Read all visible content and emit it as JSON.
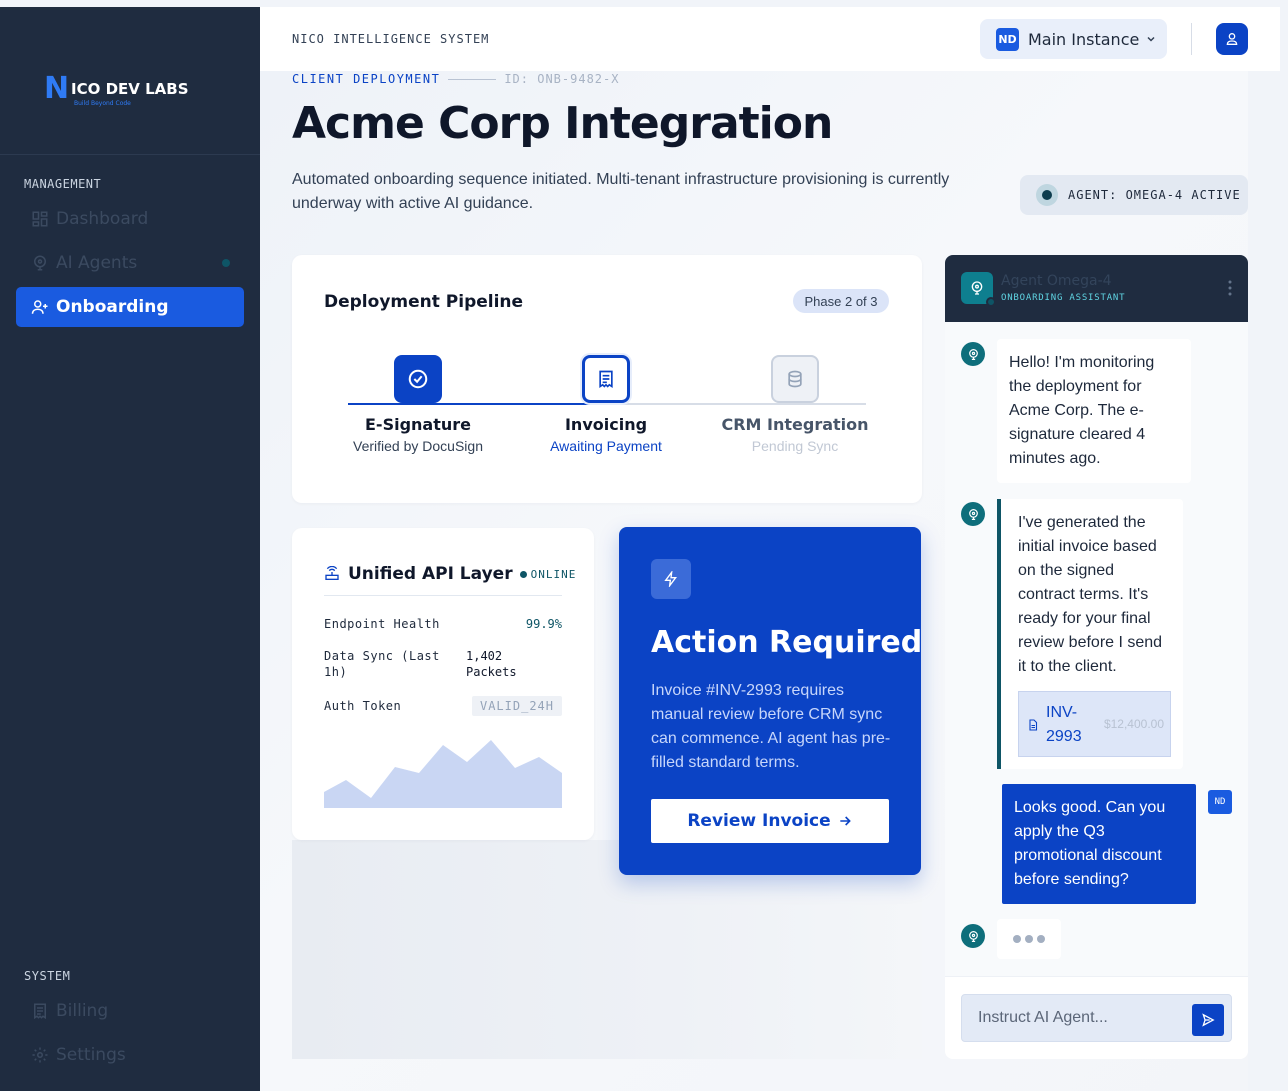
{
  "brand": {
    "logo_letter": "N",
    "logo_text": "ICO DEV LABS",
    "tagline": "Build Beyond Code"
  },
  "sidebar": {
    "section_management": "MANAGEMENT",
    "section_system": "SYSTEM",
    "items": [
      {
        "label": "Dashboard",
        "icon": "grid-icon",
        "active": false
      },
      {
        "label": "AI Agents",
        "icon": "brain-icon",
        "active": false
      },
      {
        "label": "Onboarding",
        "icon": "user-plus-icon",
        "active": true
      }
    ],
    "system_items": [
      {
        "label": "Billing",
        "icon": "receipt-icon"
      },
      {
        "label": "Settings",
        "icon": "gear-icon"
      }
    ]
  },
  "topbar": {
    "system_title": "NICO INTELLIGENCE SYSTEM",
    "instance_badge": "ND",
    "instance_label": "Main Instance",
    "icons": [
      "chevron-down-icon",
      "user-icon"
    ]
  },
  "header": {
    "breadcrumb": "CLIENT DEPLOYMENT",
    "id": "ID: ONB-9482-X",
    "title": "Acme Corp Integration",
    "description": "Automated onboarding sequence initiated. Multi-tenant infrastructure provisioning is currently underway with active AI guidance.",
    "agent_status": "AGENT: OMEGA-4 ACTIVE"
  },
  "pipeline": {
    "title": "Deployment Pipeline",
    "phase": "Phase 2 of 3",
    "progress": 0.5,
    "steps": [
      {
        "name": "E-Signature",
        "sub": "Verified by DocuSign",
        "state": "done",
        "icon": "check-circle-icon"
      },
      {
        "name": "Invoicing",
        "sub": "Awaiting Payment",
        "state": "current",
        "icon": "receipt-icon"
      },
      {
        "name": "CRM Integration",
        "sub": "Pending Sync",
        "state": "pending",
        "icon": "database-icon"
      }
    ]
  },
  "api": {
    "title": "Unified API Layer",
    "status": "ONLINE",
    "icon": "router-icon",
    "rows": [
      {
        "label": "Endpoint Health",
        "value": "99.9%"
      },
      {
        "label": "Data Sync (Last 1h)",
        "value": "1,402 Packets"
      },
      {
        "label": "Auth Token",
        "value": "VALID_24H"
      }
    ]
  },
  "action": {
    "icon": "bolt-icon",
    "title": "Action Required",
    "body": "Invoice #INV-2993 requires manual review before CRM sync can commence. AI agent has pre-filled standard terms.",
    "button": "Review Invoice",
    "button_icon": "arrow-right-icon"
  },
  "chat": {
    "agent_name": "Agent Omega-4",
    "agent_role": "ONBOARDING ASSISTANT",
    "messages": [
      {
        "from": "agent",
        "text": "Hello! I'm monitoring the deployment for Acme Corp. The e-signature cleared 4 minutes ago."
      },
      {
        "from": "agent",
        "text": "I've generated the initial invoice based on the signed contract terms. It's ready for your final review before I send it to the client.",
        "attachment": {
          "name": "INV-2993",
          "amount": "$12,400.00"
        }
      },
      {
        "from": "user",
        "text": "Looks good. Can you apply the Q3 promotional discount before sending?",
        "tag": "ND"
      }
    ],
    "input_placeholder": "Instruct AI Agent...",
    "icons": [
      "brain-icon",
      "more-vertical-icon",
      "file-icon",
      "send-icon"
    ]
  },
  "colors": {
    "accent": "#0b43c5",
    "sidebar_bg": "#1f2c40",
    "teal": "#0e5566"
  }
}
